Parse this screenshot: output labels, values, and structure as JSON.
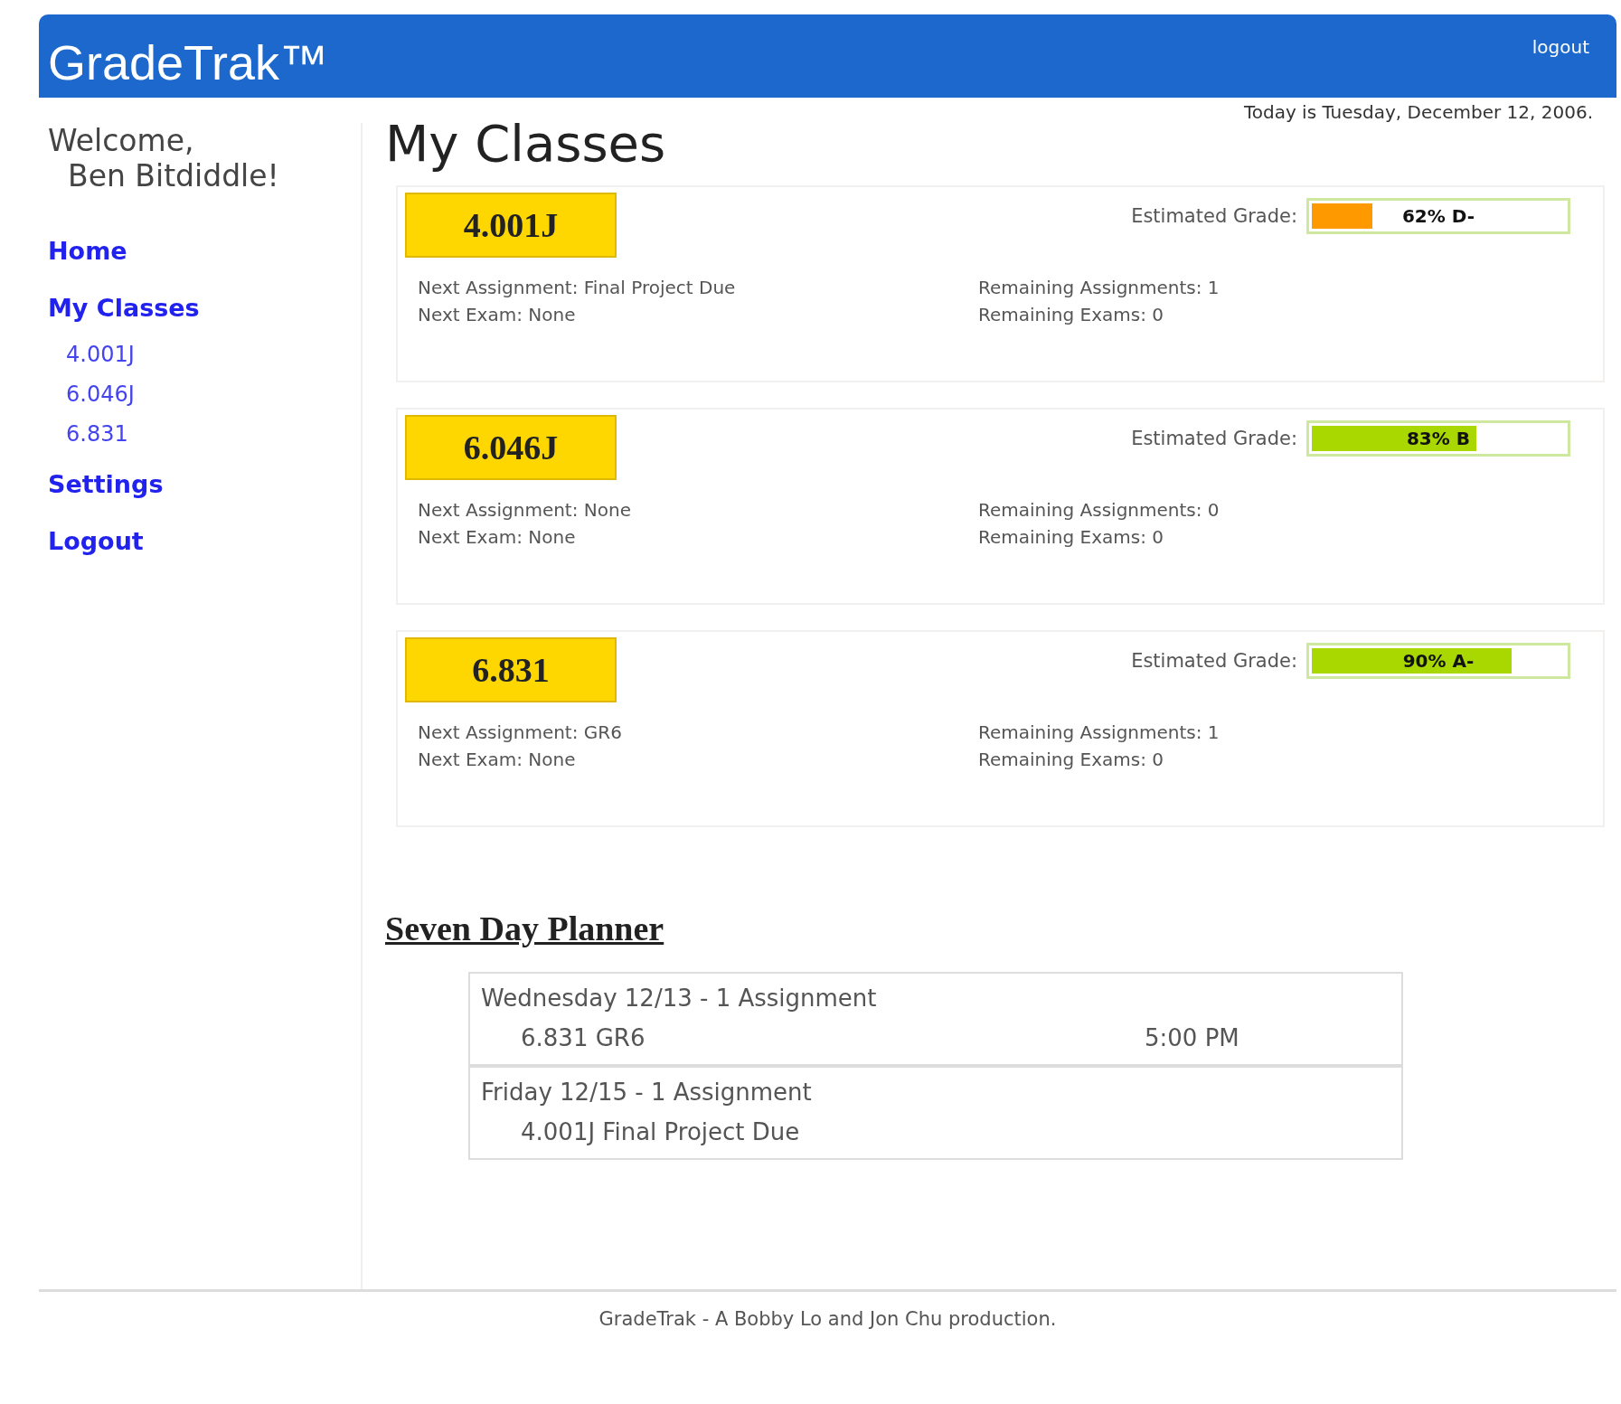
{
  "header": {
    "title": "GradeTrak™",
    "logout": "logout"
  },
  "date": "Today is Tuesday, December 12, 2006.",
  "sidebar": {
    "welcome": "Welcome,",
    "name": "Ben Bitdiddle!",
    "items": [
      {
        "label": "Home",
        "kind": "main"
      },
      {
        "label": "My Classes",
        "kind": "main"
      },
      {
        "label": "4.001J",
        "kind": "sub"
      },
      {
        "label": "6.046J",
        "kind": "sub"
      },
      {
        "label": "6.831",
        "kind": "sub"
      },
      {
        "label": "Settings",
        "kind": "main"
      },
      {
        "label": "Logout",
        "kind": "main"
      }
    ]
  },
  "heading": "My Classes",
  "classes": [
    {
      "code": "4.001J",
      "grade_label": "Estimated Grade:",
      "grade": "62% D-",
      "level": 0.24,
      "color": "#ff9900",
      "next_assignment": "Next Assignment: Final Project Due",
      "next_exam": "Next Exam: None",
      "remaining_assignments": "Remaining Assignments: 1",
      "remaining_exams": "Remaining Exams: 0"
    },
    {
      "code": "6.046J",
      "grade_label": "Estimated Grade:",
      "grade": "83% B",
      "level": 0.65,
      "color": "#a8d800",
      "next_assignment": "Next Assignment: None",
      "next_exam": "Next Exam: None",
      "remaining_assignments": "Remaining Assignments: 0",
      "remaining_exams": "Remaining Exams: 0"
    },
    {
      "code": "6.831",
      "grade_label": "Estimated Grade:",
      "grade": "90% A-",
      "level": 0.79,
      "color": "#a8d800",
      "next_assignment": "Next Assignment: GR6",
      "next_exam": "Next Exam: None",
      "remaining_assignments": "Remaining Assignments: 1",
      "remaining_exams": "Remaining Exams: 0"
    }
  ],
  "planner": {
    "title": "Seven Day Planner",
    "days": [
      {
        "heading": "Wednesday 12/13 - 1 Assignment",
        "items": [
          {
            "name": "6.831 GR6",
            "time": "5:00 PM"
          }
        ]
      },
      {
        "heading": "Friday 12/15 - 1 Assignment",
        "items": [
          {
            "name": "4.001J Final Project Due"
          }
        ]
      }
    ]
  },
  "footer": "GradeTrak - A Bobby Lo and Jon Chu production."
}
